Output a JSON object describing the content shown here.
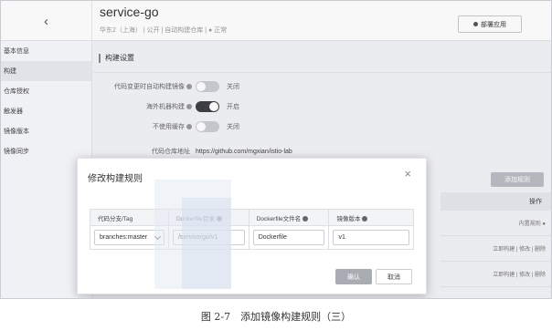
{
  "header": {
    "back_icon": "chevron-left-icon",
    "back_glyph": "‹",
    "service_name": "service-go",
    "meta": "华东2（上海） | 公开 | 自动构建仓库 | ● 正常",
    "deploy_label": "部署应用"
  },
  "sidebar": {
    "items": [
      {
        "label": "基本信息",
        "active": false
      },
      {
        "label": "构建",
        "active": true
      },
      {
        "label": "仓库授权",
        "active": false
      },
      {
        "label": "触发器",
        "active": false
      },
      {
        "label": "镜像版本",
        "active": false
      },
      {
        "label": "镜像同步",
        "active": false
      }
    ]
  },
  "build_settings": {
    "section_title": "构建设置",
    "rows": [
      {
        "label": "代码变更时自动构建镜像",
        "toggle": "off",
        "state": "关闭"
      },
      {
        "label": "海外机器构建",
        "toggle": "on",
        "state": "开启"
      },
      {
        "label": "不使用缓存",
        "toggle": "off",
        "state": "关闭"
      }
    ],
    "repo_label": "代码仓库地址",
    "repo_url": "https://github.com/mgxian/istio-lab"
  },
  "background_table": {
    "add_rule_label": "添加规则",
    "op_header": "操作",
    "rows": [
      "内置规则 ●",
      "立即构建 | 修改 | 删除",
      "立即构建 | 修改 | 删除"
    ]
  },
  "modal": {
    "title": "修改构建规则",
    "close_glyph": "×",
    "columns": [
      "代码分支/Tag",
      "Dockerfile目录",
      "Dockerfile文件名",
      "镜像版本"
    ],
    "values": {
      "branch": "branches:master",
      "dockerfile_dir": "/service/go/v1",
      "dockerfile_name": "Dockerfile",
      "image_version": "v1"
    },
    "confirm_label": "确认",
    "cancel_label": "取消"
  },
  "caption": "图 2-7　添加镜像构建规则（三）",
  "colors": {
    "toggle_on": "#3d3f45",
    "toggle_off": "#c9ccd1",
    "primary_button": "#a9acb2",
    "watermark": "#dfe6f2"
  }
}
